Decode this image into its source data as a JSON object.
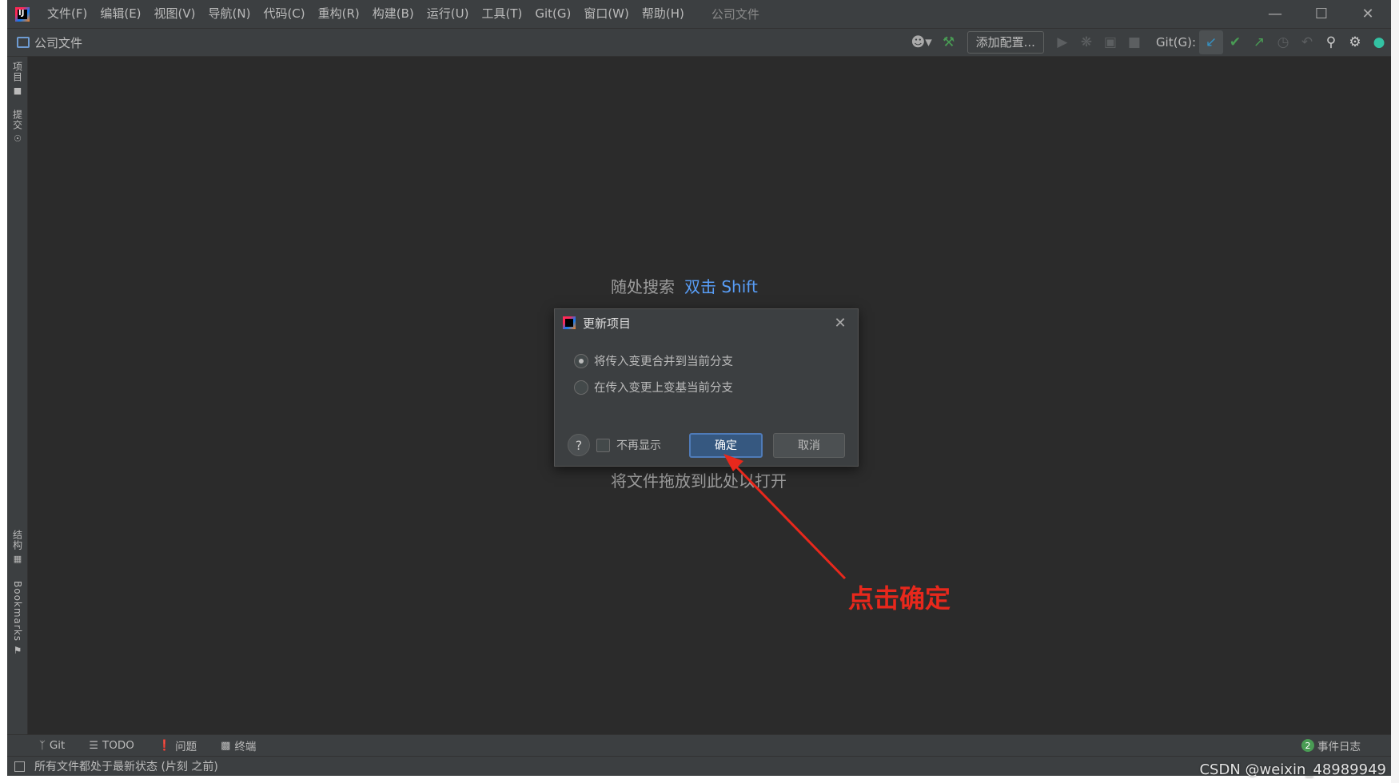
{
  "window": {
    "title": "公司文件",
    "menu": [
      "文件(F)",
      "编辑(E)",
      "视图(V)",
      "导航(N)",
      "代码(C)",
      "重构(R)",
      "构建(B)",
      "运行(U)",
      "工具(T)",
      "Git(G)",
      "窗口(W)",
      "帮助(H)"
    ]
  },
  "navbar": {
    "project": "公司文件",
    "add_config": "添加配置...",
    "git_label": "Git(G):"
  },
  "left_stripe": {
    "project": "项目",
    "commit": "提交",
    "structure": "结构",
    "bookmarks": "Bookmarks"
  },
  "editor": {
    "search_hint": "随处搜索",
    "search_shortcut": "双击 Shift",
    "drop_hint": "将文件拖放到此处以打开"
  },
  "dialog": {
    "title": "更新项目",
    "option_merge": "将传入变更合并到当前分支",
    "option_rebase": "在传入变更上变基当前分支",
    "selected": "option_merge",
    "dont_show": "不再显示",
    "ok": "确定",
    "cancel": "取消",
    "help": "?"
  },
  "annotation": {
    "text": "点击确定",
    "color": "#e8281c"
  },
  "bottom_tools": {
    "git": "Git",
    "todo": "TODO",
    "problems": "问题",
    "terminal": "终端",
    "event_log": "事件日志",
    "event_count": "2"
  },
  "status": {
    "message": "所有文件都处于最新状态 (片刻 之前)"
  },
  "watermark": "CSDN @weixin_48989949",
  "colors": {
    "accent": "#589df6",
    "ok_button": "#365880",
    "background": "#2b2b2b",
    "panel": "#3c3f41"
  }
}
